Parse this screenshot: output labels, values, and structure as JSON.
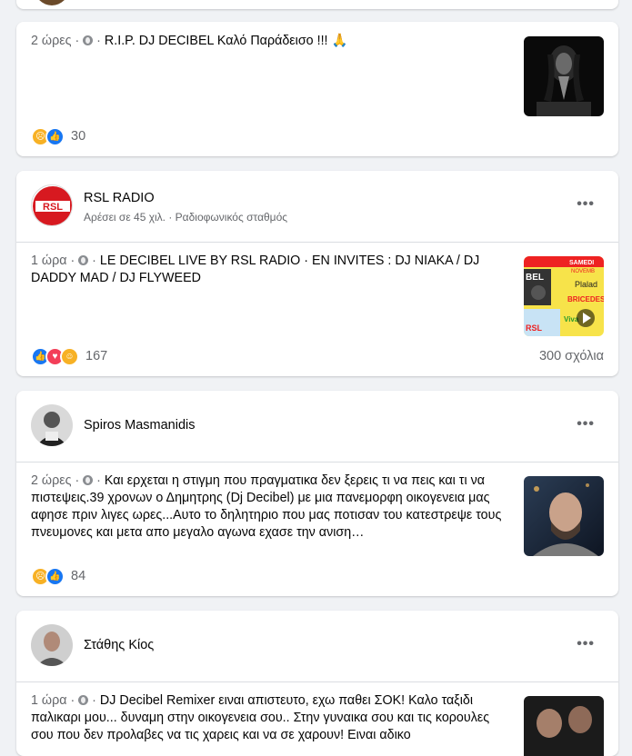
{
  "posts": [
    {
      "time": "2 ώρες",
      "text": "R.I.P. DJ DECIBEL Καλό Παράδεισο !!! 🙏",
      "reaction_count": "30",
      "reactions": [
        "sad-icon",
        "like-icon"
      ]
    },
    {
      "author": "RSL RADIO",
      "subtitle": "Αρέσει σε 45 χιλ. · Ραδιοφωνικός σταθμός",
      "time": "1 ώρα",
      "text": "LE DECIBEL LIVE BY RSL RADIO · EN INVITES : DJ NIAKA / DJ DADDY MAD / DJ FLYWEED",
      "reaction_count": "167",
      "comments": "300 σχόλια",
      "reactions": [
        "like-icon",
        "love-icon",
        "care-icon"
      ],
      "avatar_text": "RSL",
      "thumb_texts": [
        "SAMEDI",
        "NOVEMB",
        "BEL",
        "Plalad",
        "BRICEDES",
        "RSL",
        "Viva"
      ]
    },
    {
      "author": "Spiros Masmanidis",
      "time": "2 ώρες",
      "text": "Και ερχεται η στιγμη που πραγματικα δεν ξερεις τι να πεις και τι να πιστεψεις.39 χρονων ο Δημητρης (Dj Decibel) με μια πανεμορφη οικογενεια μας αφησε πριν λιγες ωρες...Αυτο το δηλητηριο που μας ποτισαν του κατεστρεψε τους πνευμονες και μετα απο μεγαλο αγωνα εχασε την ανιση…",
      "reaction_count": "84",
      "reactions": [
        "sad-icon",
        "like-icon"
      ]
    },
    {
      "author": "Στάθης Κίος",
      "time": "1 ώρα",
      "text": "DJ Decibel Remixer ειναι απιστευτο, εχω παθει ΣΟΚ! Καλο ταξιδι παλικαρι μου... δυναμη στην οικογενεια σου.. Στην γυναικα σου και τις κορουλες σου που δεν προλαβες να τις χαρεις και να σε χαρουν! Ειναι αδικο"
    }
  ],
  "separator": " · ",
  "more_label": "•••",
  "colors": {
    "like": "#1877f2",
    "love": "#f33e58",
    "sad": "#f7b125",
    "meta_text": "#65676b",
    "background": "#f0f2f5"
  }
}
